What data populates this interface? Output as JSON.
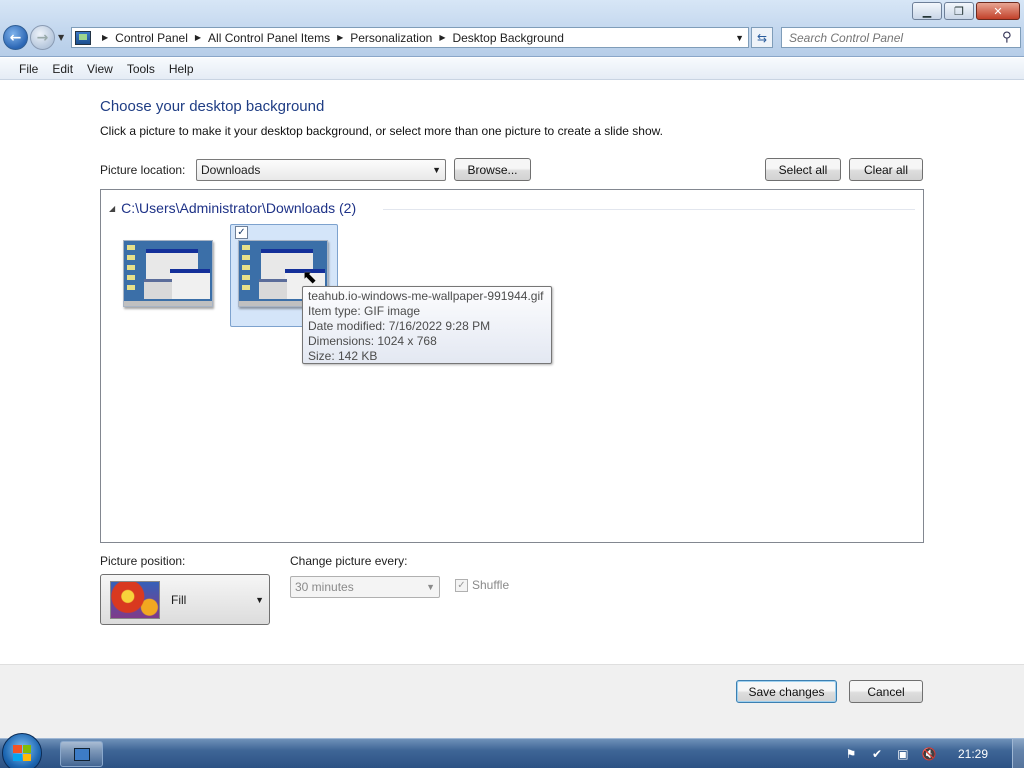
{
  "window": {
    "minimize_glyph": "▁",
    "maximize_glyph": "❐",
    "close_glyph": "✕"
  },
  "address": {
    "breadcrumbs": [
      "Control Panel",
      "All Control Panel Items",
      "Personalization",
      "Desktop Background"
    ],
    "search_placeholder": "Search Control Panel"
  },
  "menu": {
    "items": [
      "File",
      "Edit",
      "View",
      "Tools",
      "Help"
    ]
  },
  "page": {
    "title": "Choose your desktop background",
    "subtitle": "Click a picture to make it your desktop background, or select more than one picture to create a slide show.",
    "picture_location_label": "Picture location:",
    "picture_location_value": "Downloads",
    "browse_label": "Browse...",
    "select_all_label": "Select all",
    "clear_all_label": "Clear all",
    "group_header": "C:\\Users\\Administrator\\Downloads (2)",
    "tooltip": {
      "filename": "teahub.io-windows-me-wallpaper-991944.gif",
      "item_type": "Item type: GIF image",
      "date_modified": "Date modified: 7/16/2022 9:28 PM",
      "dimensions": "Dimensions: 1024 x 768",
      "size": "Size: 142 KB"
    },
    "picture_position_label": "Picture position:",
    "picture_position_value": "Fill",
    "change_every_label": "Change picture every:",
    "change_every_value": "30 minutes",
    "shuffle_label": "Shuffle"
  },
  "footer": {
    "save_label": "Save changes",
    "cancel_label": "Cancel"
  },
  "taskbar": {
    "clock": "21:29"
  }
}
